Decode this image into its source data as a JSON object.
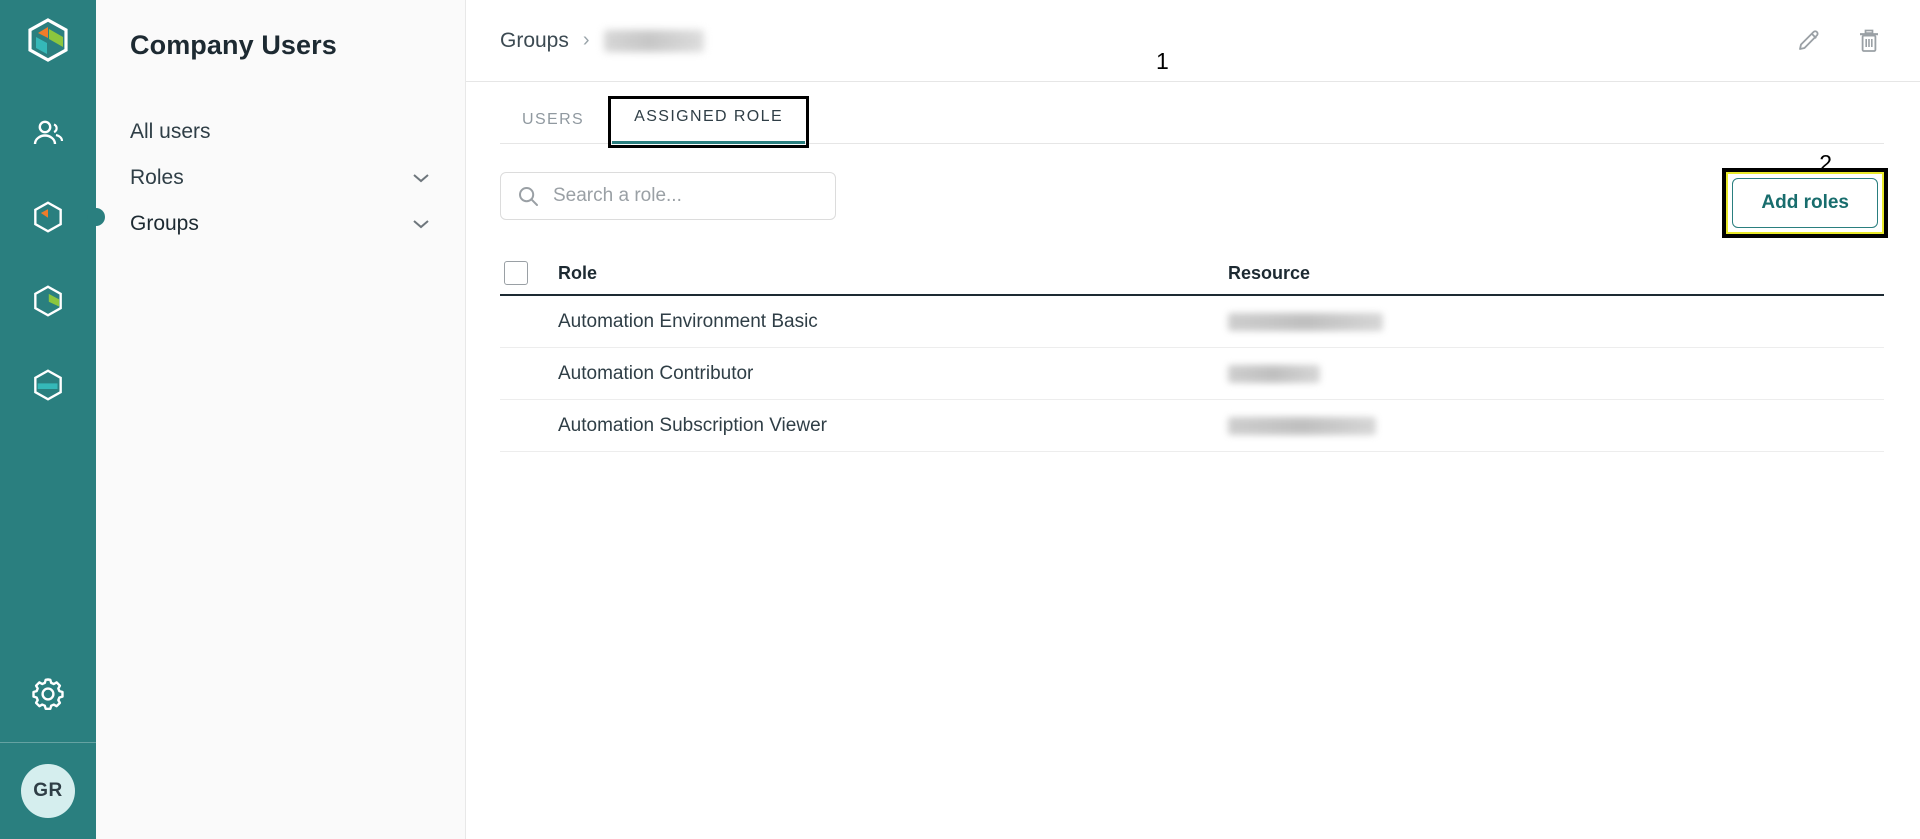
{
  "rail": {
    "logo": "cube-logo",
    "items": [
      {
        "name": "users",
        "icon": "people-icon",
        "active": false
      },
      {
        "name": "groups",
        "icon": "cube-orange-icon",
        "active": true
      },
      {
        "name": "catalog",
        "icon": "cube-green-icon",
        "active": false
      },
      {
        "name": "deployments",
        "icon": "cube-teal-icon",
        "active": false
      }
    ],
    "settings_icon": "gear-icon",
    "avatar_initials": "GR"
  },
  "sidebar": {
    "title": "Company Users",
    "items": [
      {
        "label": "All users",
        "expandable": false,
        "active": false
      },
      {
        "label": "Roles",
        "expandable": true,
        "active": false
      },
      {
        "label": "Groups",
        "expandable": true,
        "active": true
      }
    ]
  },
  "topbar": {
    "breadcrumb_root": "Groups",
    "breadcrumb_separator": "›",
    "breadcrumb_current": "",
    "edit_icon": "pencil-icon",
    "delete_icon": "trash-icon"
  },
  "tabs": [
    {
      "label": "USERS",
      "active": false,
      "annotated": false
    },
    {
      "label": "ASSIGNED ROLE",
      "active": true,
      "annotated": true
    }
  ],
  "annotations": [
    {
      "id": "1",
      "target": "assigned-role-tab"
    },
    {
      "id": "2",
      "target": "add-roles-button"
    }
  ],
  "search": {
    "placeholder": "Search a role...",
    "value": "",
    "icon": "search-icon"
  },
  "add_roles_button": {
    "label": "Add roles"
  },
  "table": {
    "columns": [
      "Role",
      "Resource"
    ],
    "rows": [
      {
        "role": "Automation Environment Basic",
        "resource": "",
        "resource_redacted": true,
        "redact_width": 155
      },
      {
        "role": "Automation Contributor",
        "resource": "",
        "resource_redacted": true,
        "redact_width": 92
      },
      {
        "role": "Automation Subscription Viewer",
        "resource": "",
        "resource_redacted": true,
        "redact_width": 148
      }
    ]
  },
  "colors": {
    "rail_bg": "#2a7f7f",
    "accent": "#2a7f7f",
    "button_text": "#186d6d",
    "annotation_box": "#000000",
    "annotation_highlight": "#e8e82a",
    "avatar_bg": "#d5eeee"
  }
}
